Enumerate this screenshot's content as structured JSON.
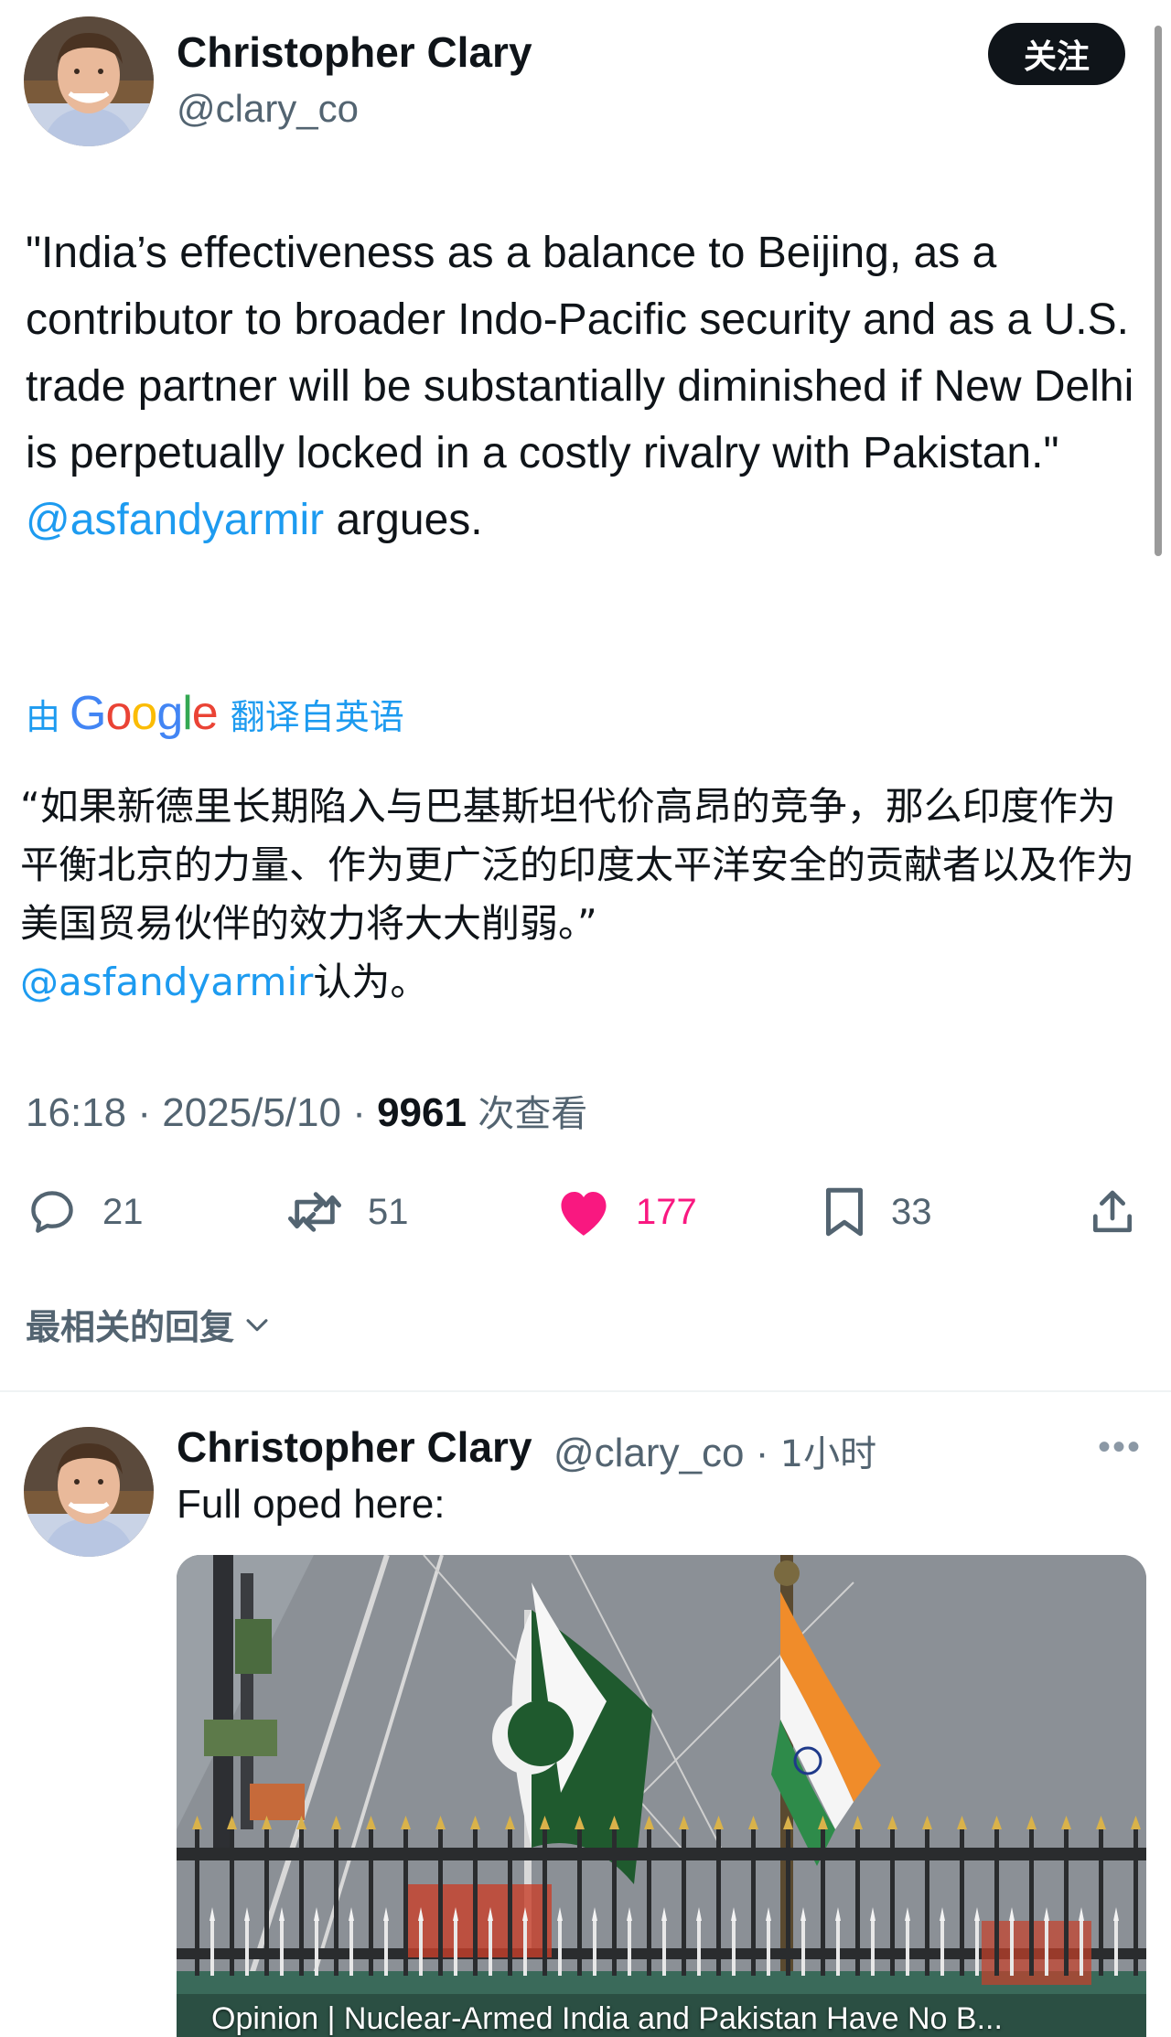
{
  "tweet": {
    "author_name": "Christopher Clary",
    "author_handle": "@clary_co",
    "follow_label": "关注",
    "text_before_mention": "\"India’s effectiveness as a balance to Beijing, as a contributor to broader Indo-Pacific security and as a U.S. trade partner will be substantially diminished if New Delhi is perpetually locked in a costly rivalry with Pakistan.\" ",
    "mention": "@asfandyarmir",
    "text_after_mention": " argues.",
    "translate_by": "由",
    "translate_brand": "Google",
    "translate_from": "翻译自英语",
    "translated_text": "“如果新德里长期陷入与巴基斯坦代价高昂的竞争，那么印度作为平衡北京的力量、作为更广泛的印度太平洋安全的贡献者以及作为美国贸易伙伴的效力将大大削弱。”",
    "translated_mention": "@asfandyarmir",
    "translated_after_mention": "认为。",
    "time": "16:18",
    "date": "2025/5/10",
    "views_count": "9961",
    "views_label": "次查看",
    "replies_count": "21",
    "retweets_count": "51",
    "likes_count": "177",
    "bookmarks_count": "33"
  },
  "replies_section": {
    "sort_label": "最相关的回复"
  },
  "reply": {
    "author_name": "Christopher Clary",
    "author_handle": "@clary_co",
    "time": "1小时",
    "text": "Full oped here:",
    "card_caption": "Opinion | Nuclear-Armed India and Pakistan Have No B..."
  },
  "colors": {
    "accent": "#1d9bf0",
    "like": "#f91880",
    "text": "#0f1419",
    "secondary": "#536471"
  }
}
